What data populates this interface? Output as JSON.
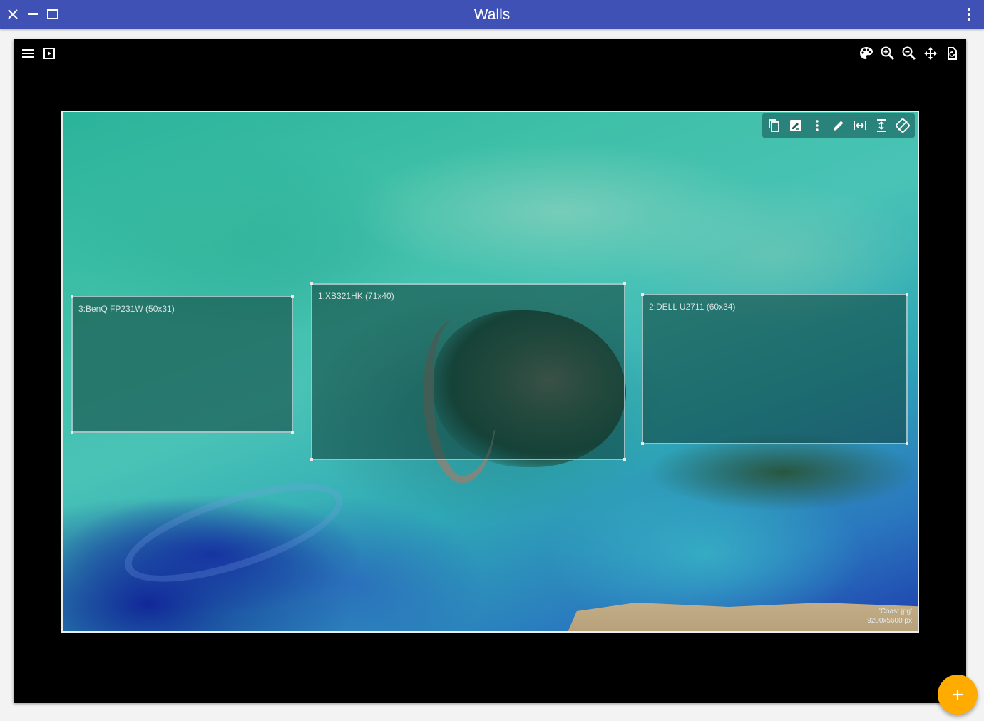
{
  "window": {
    "title": "Walls",
    "controls": [
      "close-icon",
      "minimize-icon",
      "maximize-icon",
      "more-vertical-icon"
    ]
  },
  "canvas_toolbar": {
    "left": [
      "menu-icon",
      "slideshow-icon"
    ],
    "right": [
      "palette-icon",
      "zoom-in-icon",
      "zoom-out-icon",
      "move-icon",
      "reset-view-icon"
    ]
  },
  "image_toolbar": {
    "buttons": [
      "copy-icon",
      "edit-image-icon",
      "more-vertical-icon",
      "pencil-icon",
      "fit-width-icon",
      "fit-height-icon",
      "rotate-icon"
    ]
  },
  "wallpaper": {
    "filename": "'Coast.jpg'",
    "dimensions": "9200x5600 px"
  },
  "monitors": [
    {
      "label": "3:BenQ FP231W (50x31)"
    },
    {
      "label": "1:XB321HK (71x40)"
    },
    {
      "label": "2:DELL U2711 (60x34)"
    }
  ],
  "fab": {
    "icon": "plus-icon"
  },
  "colors": {
    "titlebar": "#3f51b5",
    "fab": "#ffab00",
    "canvas": "#000000"
  }
}
